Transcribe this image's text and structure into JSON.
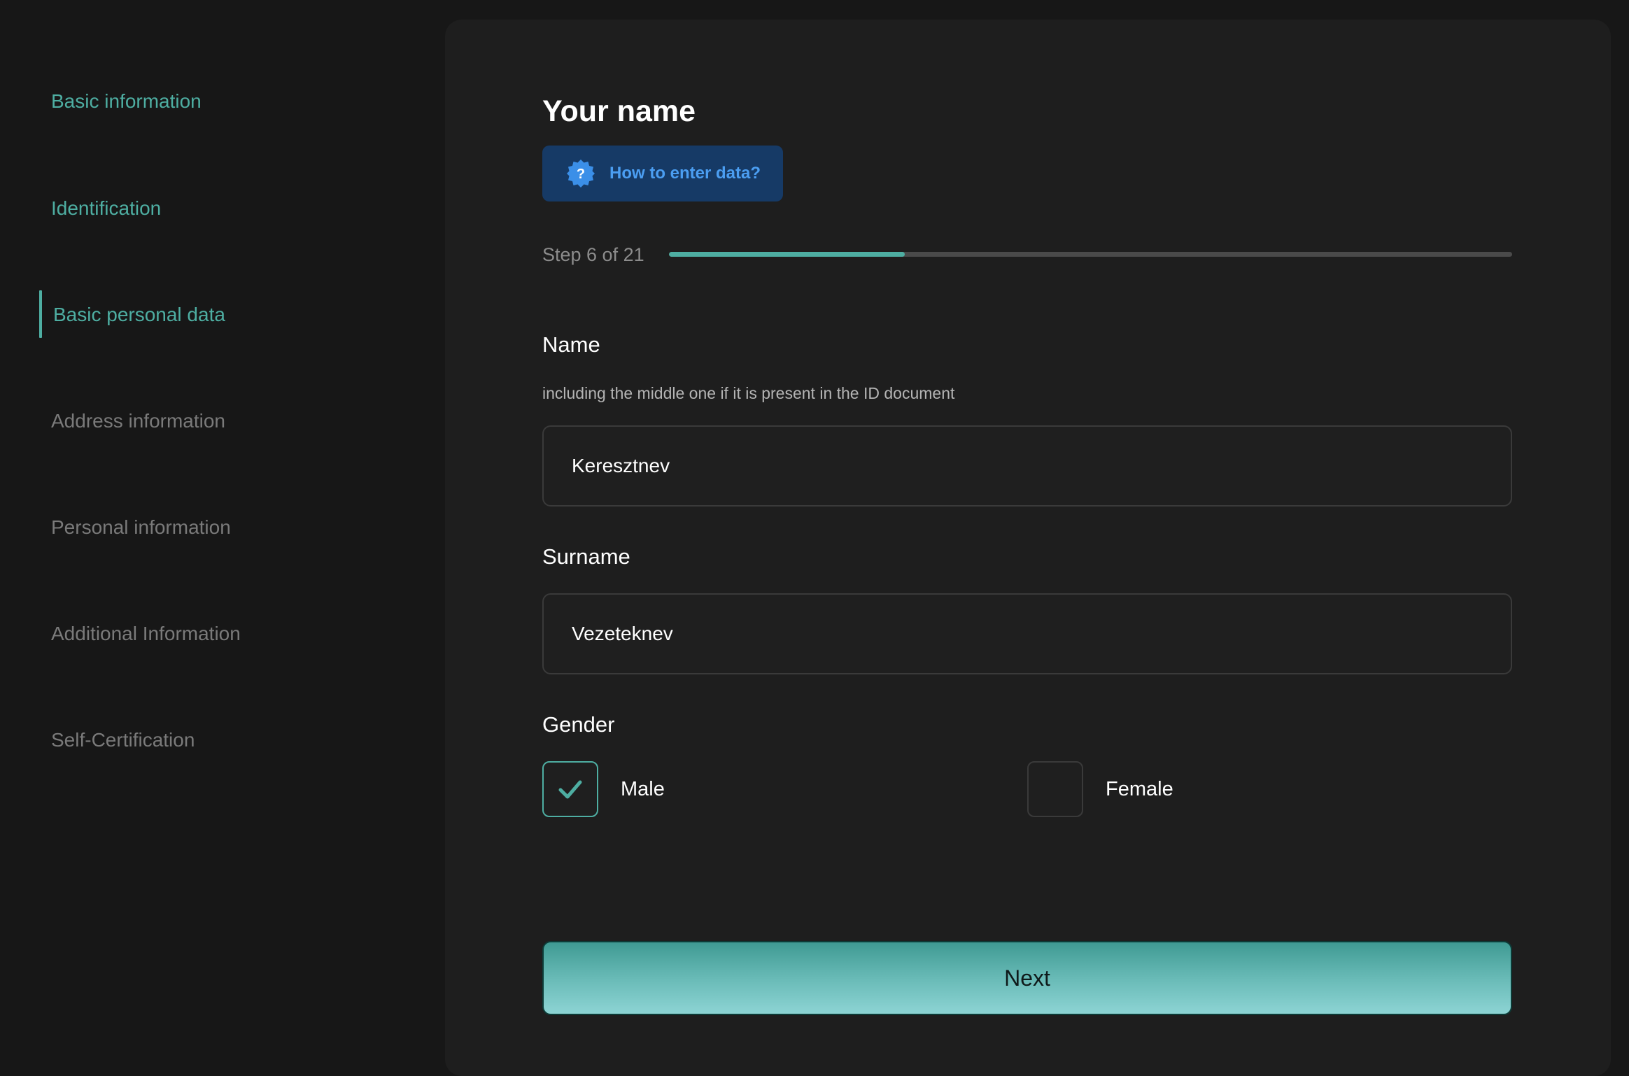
{
  "sidebar": {
    "items": [
      {
        "label": "Basic information",
        "state": "done"
      },
      {
        "label": "Identification",
        "state": "done"
      },
      {
        "label": "Basic personal data",
        "state": "active"
      },
      {
        "label": "Address information",
        "state": "pending"
      },
      {
        "label": "Personal information",
        "state": "pending"
      },
      {
        "label": "Additional Information",
        "state": "pending"
      },
      {
        "label": "Self-Certification",
        "state": "pending"
      }
    ]
  },
  "main": {
    "title": "Your name",
    "help_button": {
      "label": "How to enter data?",
      "icon": "question-badge-icon"
    },
    "step": {
      "label": "Step 6 of 21",
      "current": 6,
      "total": 21,
      "progress_fraction": 0.28
    },
    "name": {
      "label": "Name",
      "hint": "including the middle one if it is present in the ID document",
      "value": "Keresztnev"
    },
    "surname": {
      "label": "Surname",
      "value": "Vezeteknev"
    },
    "gender": {
      "label": "Gender",
      "options": [
        {
          "label": "Male",
          "checked": true
        },
        {
          "label": "Female",
          "checked": false
        }
      ]
    },
    "next_button": {
      "label": "Next"
    }
  },
  "colors": {
    "accent": "#4eaea2",
    "background": "#171717",
    "panel": "#1e1e1e",
    "help_bg": "#163a66",
    "help_text": "#4b9ef2"
  }
}
